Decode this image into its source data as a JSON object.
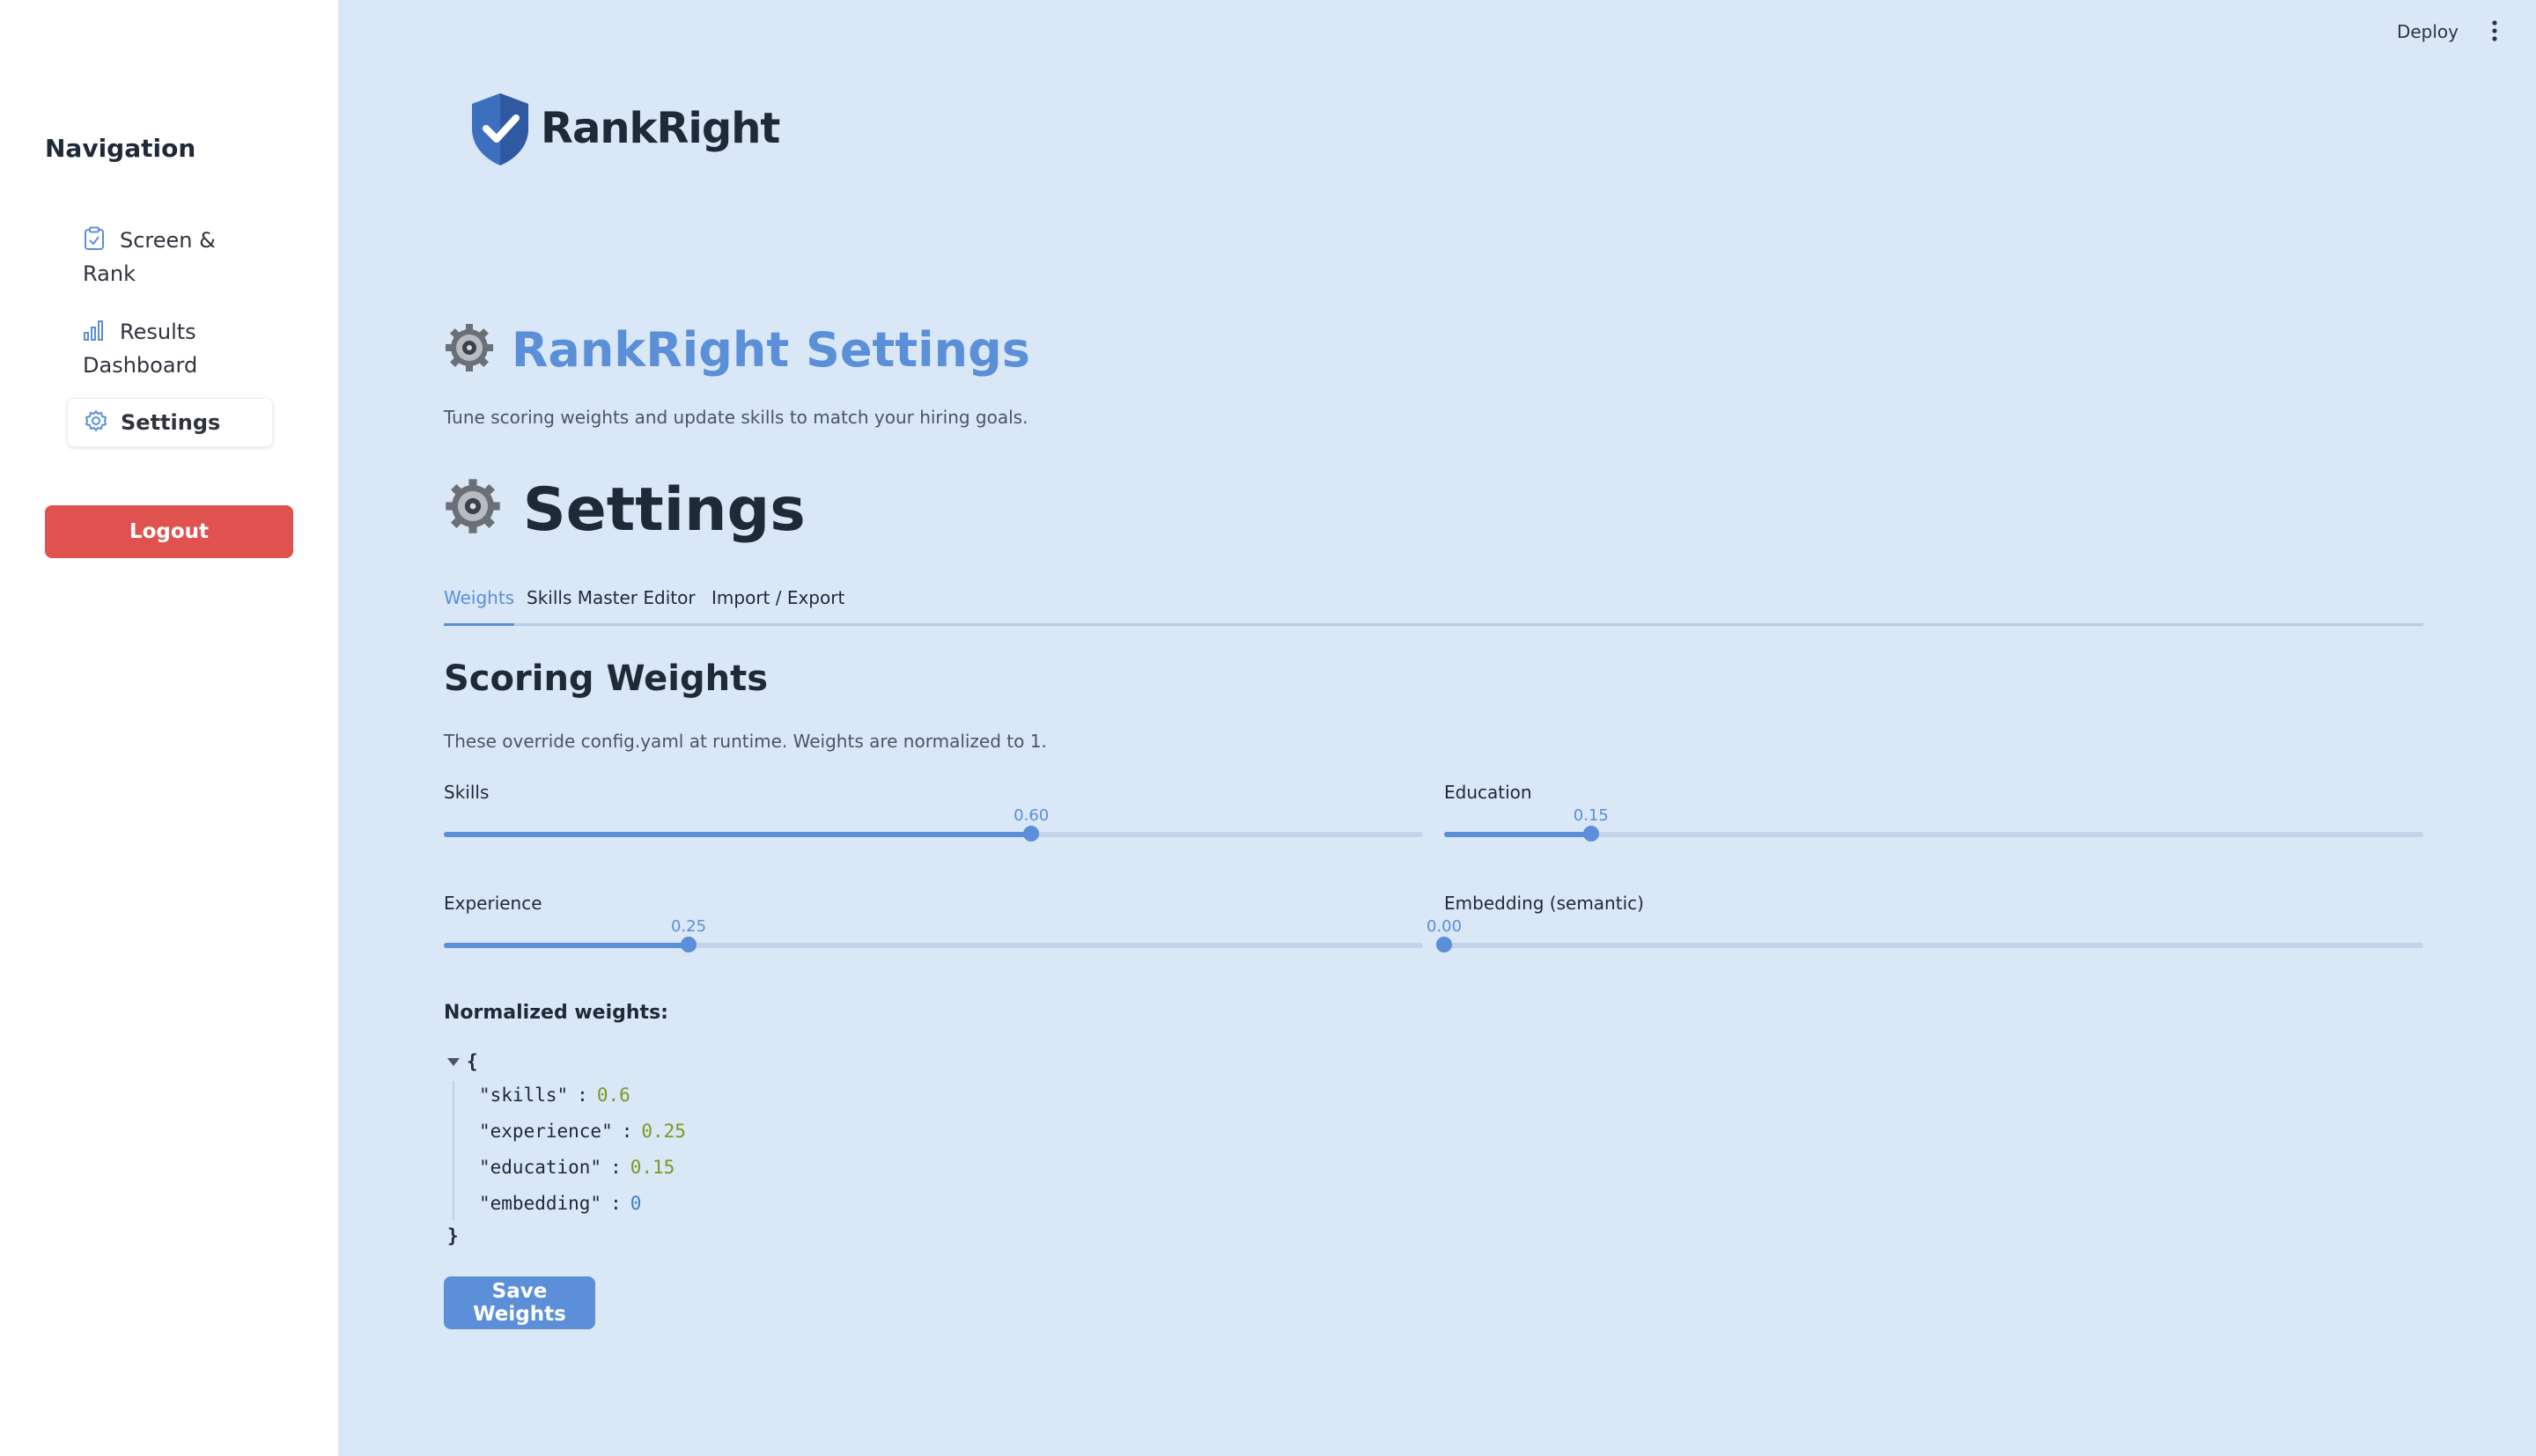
{
  "sidebar": {
    "title": "Navigation",
    "items": [
      {
        "label_line1": "Screen &",
        "label_line2": "Rank",
        "icon": "clipboard-icon"
      },
      {
        "label_line1": "Results",
        "label_line2": "Dashboard",
        "icon": "bar-chart-icon"
      },
      {
        "label": "Settings",
        "icon": "gear-outline-icon",
        "active": true
      }
    ],
    "logout_label": "Logout"
  },
  "header": {
    "deploy_label": "Deploy",
    "menu_icon": "kebab-menu-icon"
  },
  "brand": {
    "name": "RankRight",
    "logo_icon": "shield-check-icon"
  },
  "page": {
    "title": "RankRight Settings",
    "subtitle": "Tune scoring weights and update skills to match your hiring goals.",
    "settings_heading": "Settings"
  },
  "tabs": [
    {
      "label": "Weights",
      "active": true
    },
    {
      "label": "Skills Master Editor",
      "active": false
    },
    {
      "label": "Import / Export",
      "active": false
    }
  ],
  "weights": {
    "heading": "Scoring Weights",
    "description": "These override config.yaml at runtime. Weights are normalized to 1.",
    "sliders": [
      {
        "label": "Skills",
        "value": 0.6,
        "display": "0.60",
        "min": 0,
        "max": 1
      },
      {
        "label": "Education",
        "value": 0.15,
        "display": "0.15",
        "min": 0,
        "max": 1
      },
      {
        "label": "Experience",
        "value": 0.25,
        "display": "0.25",
        "min": 0,
        "max": 1
      },
      {
        "label": "Embedding (semantic)",
        "value": 0.0,
        "display": "0.00",
        "min": 0,
        "max": 1
      }
    ],
    "normalized_label": "Normalized weights:",
    "json_open": "{",
    "json_close": "}",
    "normalized": [
      {
        "key": "\"skills\"",
        "sep": ":",
        "value": "0.6"
      },
      {
        "key": "\"experience\"",
        "sep": ":",
        "value": "0.25"
      },
      {
        "key": "\"education\"",
        "sep": ":",
        "value": "0.15"
      },
      {
        "key": "\"embedding\"",
        "sep": ":",
        "value": "0"
      }
    ],
    "save_label": "Save Weights"
  },
  "colors": {
    "accent": "#5b8fd8",
    "logout": "#e0524f",
    "main_bg": "#d9e7f6"
  }
}
